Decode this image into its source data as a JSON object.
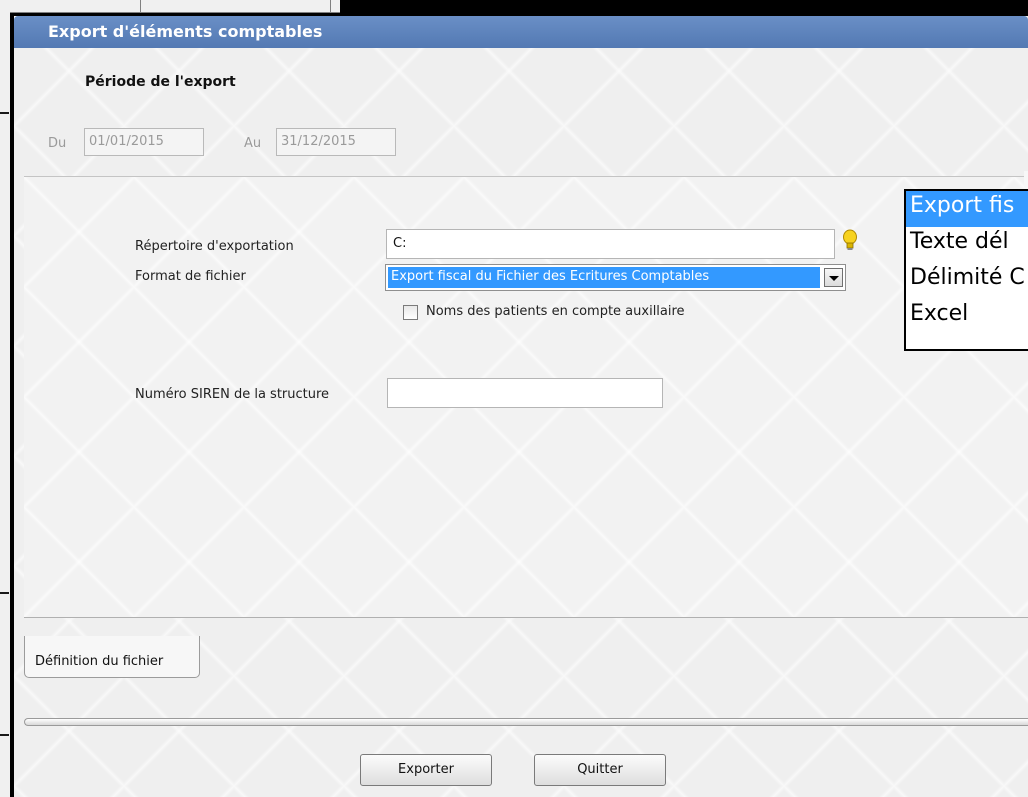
{
  "window": {
    "title": "Export d'éléments comptables"
  },
  "period": {
    "heading": "Période de l'export",
    "from_label": "Du",
    "from_value": "01/01/2015",
    "to_label": "Au",
    "to_value": "31/12/2015"
  },
  "form": {
    "directory_label": "Répertoire d'exportation",
    "directory_value": "C:",
    "format_label": "Format de fichier",
    "format_value": "Export fiscal du Fichier des Ecritures Comptables",
    "patients_checkbox_label": "Noms des patients en compte auxillaire",
    "patients_checkbox_checked": false,
    "siren_label": "Numéro SIREN de la structure",
    "siren_value": ""
  },
  "format_dropdown": {
    "options": [
      "Export fis",
      "Texte dél",
      "Délimité C",
      "Excel"
    ],
    "selected_index": 0
  },
  "tabs": [
    {
      "label": "Définition du fichier",
      "active": true
    }
  ],
  "buttons": {
    "export_label": "Exporter",
    "quit_label": "Quitter"
  },
  "colors": {
    "title_bar": "#5b82bd",
    "selection": "#3399ff",
    "hint_icon": "#f2c200"
  }
}
